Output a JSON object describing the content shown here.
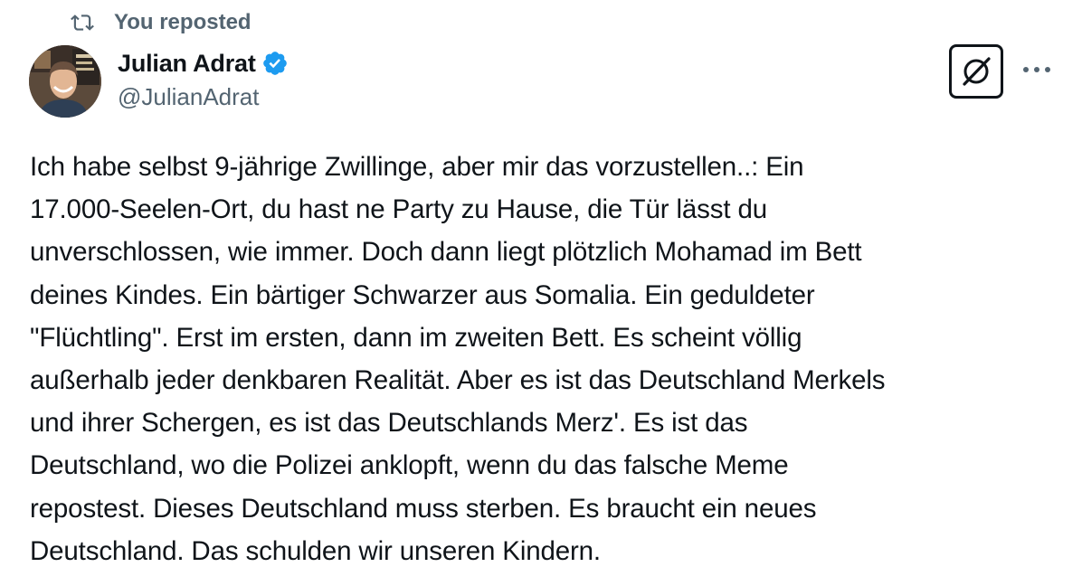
{
  "repost": {
    "label": "You reposted",
    "icon": "repost-icon"
  },
  "author": {
    "display_name": "Julian Adrat",
    "handle": "@JulianAdrat",
    "verified": true,
    "verified_color": "#1d9bf0",
    "avatar": "avatar-photo"
  },
  "actions": {
    "grok_icon": "grok-icon",
    "more_icon": "more-dots-icon"
  },
  "tweet": {
    "lines": [
      "Ich habe selbst 9-jährige Zwillinge, aber mir das vorzustellen..: Ein",
      "17.000-Seelen-Ort, du hast ne Party zu Hause, die Tür lässt du",
      "unverschlossen, wie immer. Doch dann liegt plötzlich Mohamad im Bett",
      "deines Kindes. Ein bärtiger Schwarzer aus Somalia. Ein geduldeter",
      "\"Flüchtling\". Erst im ersten, dann im zweiten Bett. Es scheint völlig",
      "außerhalb jeder denkbaren Realität. Aber es ist das Deutschland Merkels",
      "und ihrer Schergen, es ist das Deutschlands Merz'. Es ist das",
      "Deutschland, wo die Polizei anklopft, wenn du das falsche Meme",
      "repostest. Dieses Deutschland muss sterben. Es braucht ein neues",
      "Deutschland. Das schulden wir unseren Kindern."
    ]
  },
  "colors": {
    "text_primary": "#0f1419",
    "text_secondary": "#536471",
    "background": "#ffffff"
  }
}
